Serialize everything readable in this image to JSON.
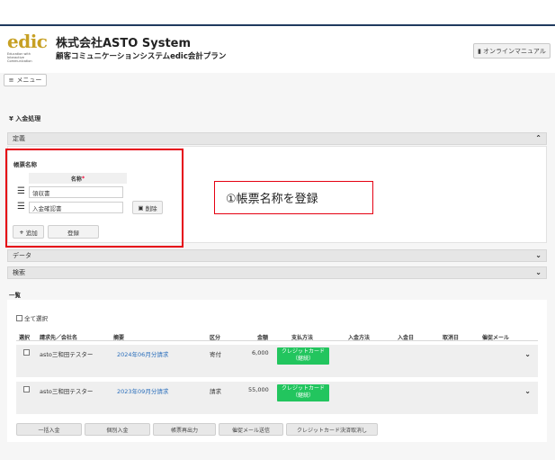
{
  "header": {
    "logo_text": "edic",
    "logo_tagline": "Education with Interactive Communication",
    "company": "株式会社ASTO System",
    "subtitle": "顧客コミュニケーションシステムedic会計プラン",
    "manual_label": "オンラインマニュアル",
    "menu_label": "メニュー"
  },
  "page": {
    "title": "¥ 入金処理"
  },
  "sections": {
    "definition": "定義",
    "data": "データ",
    "search": "検索"
  },
  "form_panel": {
    "title": "帳票名称",
    "column_header": "名称",
    "required_mark": "*",
    "items": [
      {
        "value": "領収書"
      },
      {
        "value": "入金確認書"
      }
    ],
    "delete_label": "削除",
    "add_label": "追加",
    "register_label": "登録"
  },
  "callout": {
    "text": "①帳票名称を登録"
  },
  "list": {
    "section_label": "一覧",
    "select_all_label": "全て選択",
    "columns": [
      "選択",
      "請求先／会社名",
      "摘要",
      "区分",
      "金額",
      "支払方法",
      "入金方法",
      "入金日",
      "取消日",
      "催促メール"
    ],
    "rows": [
      {
        "customer": "asto三和田テスター",
        "summary": "2024年06月分請求",
        "category": "寄付",
        "amount": "6,000",
        "payment_method": "クレジットカード\n（継続）"
      },
      {
        "customer": "asto三和田テスター",
        "summary": "2023年09月分請求",
        "category": "請求",
        "amount": "55,000",
        "payment_method": "クレジットカード\n（継続）"
      }
    ],
    "actions": [
      "一括入金",
      "個別入金",
      "帳票再出力",
      "催促メール送信",
      "クレジットカード決済取消し"
    ]
  },
  "colors": {
    "accent_red": "#e50012",
    "badge_green": "#22c55e",
    "link_blue": "#2a6ebb",
    "logo_gold": "#c7a024"
  }
}
